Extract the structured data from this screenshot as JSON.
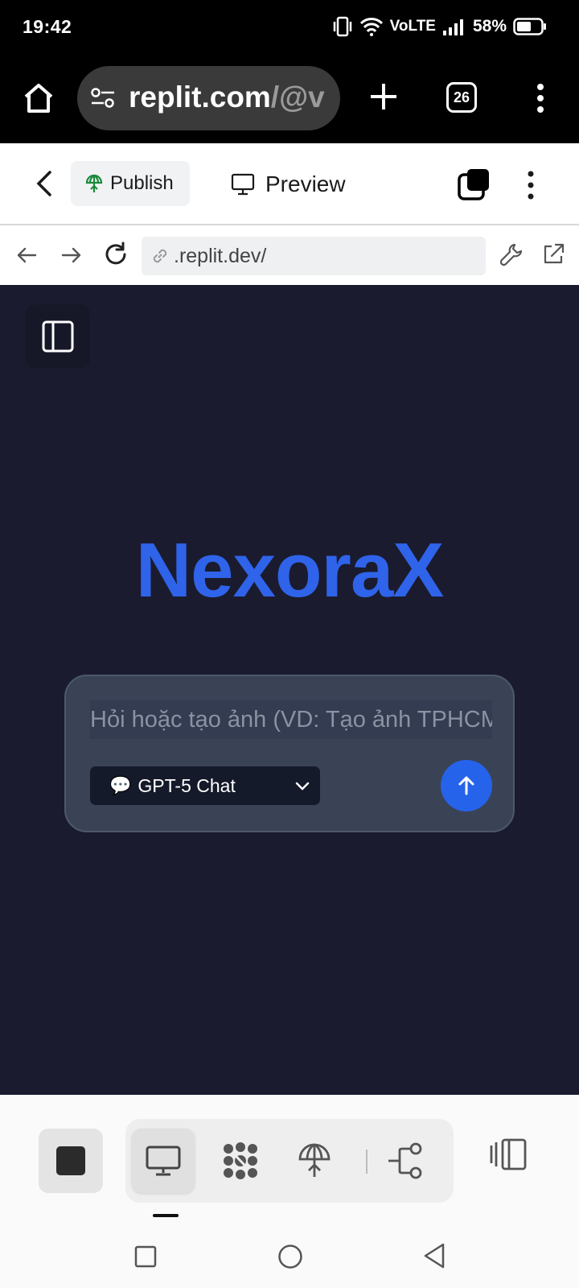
{
  "status_bar": {
    "time": "19:42",
    "network_label": "VoLTE",
    "battery_percent": "58%",
    "battery_level": 0.58
  },
  "browser": {
    "url_main": "replit.com",
    "url_dim": "/@v",
    "tab_count": "26"
  },
  "replit_toolbar": {
    "publish_label": "Publish",
    "preview_label": "Preview"
  },
  "webview": {
    "url": ".replit.dev/"
  },
  "app": {
    "title": "NexoraX",
    "title_color": "#2f63ea",
    "chat_placeholder": "Hỏi hoặc tạo ảnh (VD: Tạo ảnh TPHCM)",
    "model_emoji": "💬",
    "model_label": "GPT-5 Chat",
    "send_color": "#2563eb"
  },
  "bottom_toolbar": {
    "items": [
      "stop",
      "preview",
      "agent",
      "publish",
      "git",
      "panels"
    ],
    "active": "preview"
  }
}
